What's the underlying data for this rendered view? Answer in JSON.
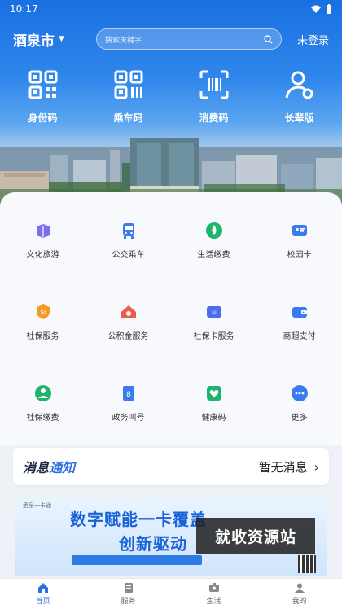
{
  "status_bar": {
    "time": "10:17"
  },
  "header": {
    "city": "酒泉市",
    "search_placeholder": "搜索关键字",
    "login": "未登录"
  },
  "quick_actions": [
    {
      "label": "身份码",
      "icon": "id-qr-icon"
    },
    {
      "label": "乘车码",
      "icon": "bus-qr-icon"
    },
    {
      "label": "消费码",
      "icon": "scan-pay-icon"
    },
    {
      "label": "长辈版",
      "icon": "elder-mode-icon"
    }
  ],
  "services": [
    {
      "label": "文化旅游",
      "icon": "culture-tour-icon",
      "color": "#7b6cf0"
    },
    {
      "label": "公交乘车",
      "icon": "bus-icon",
      "color": "#3a7cf0"
    },
    {
      "label": "生活缴费",
      "icon": "utility-icon",
      "color": "#20b36b"
    },
    {
      "label": "校园卡",
      "icon": "campus-card-icon",
      "color": "#3a7cf0"
    },
    {
      "label": "社保服务",
      "icon": "social-security-icon",
      "color": "#f29b2a"
    },
    {
      "label": "公积金服务",
      "icon": "housing-fund-icon",
      "color": "#ef5a4a"
    },
    {
      "label": "社保卡服务",
      "icon": "ss-card-icon",
      "color": "#4d6cf0"
    },
    {
      "label": "商超支付",
      "icon": "wallet-icon",
      "color": "#3a7cf0"
    },
    {
      "label": "社保缴费",
      "icon": "ss-payment-icon",
      "color": "#20b36b"
    },
    {
      "label": "政务叫号",
      "icon": "queue-icon",
      "color": "#3a7cf0"
    },
    {
      "label": "健康码",
      "icon": "health-code-icon",
      "color": "#20b36b"
    },
    {
      "label": "更多",
      "icon": "more-icon",
      "color": "#3a7cf0"
    }
  ],
  "notice": {
    "title_a": "消息",
    "title_b": "通知",
    "status": "暂无消息"
  },
  "banner": {
    "small_text": "酒泉一卡通",
    "line1": "数字赋能一卡覆盖",
    "line2": "创新驱动",
    "watermark": "就收资源站"
  },
  "bottom_nav": [
    {
      "label": "首页",
      "icon": "home-icon",
      "active": true
    },
    {
      "label": "服务",
      "icon": "service-icon",
      "active": false
    },
    {
      "label": "生活",
      "icon": "life-icon",
      "active": false
    },
    {
      "label": "我的",
      "icon": "profile-icon",
      "active": false
    }
  ],
  "colors": {
    "brand": "#2b6fe6",
    "header_blue": "#1a6fe0"
  }
}
